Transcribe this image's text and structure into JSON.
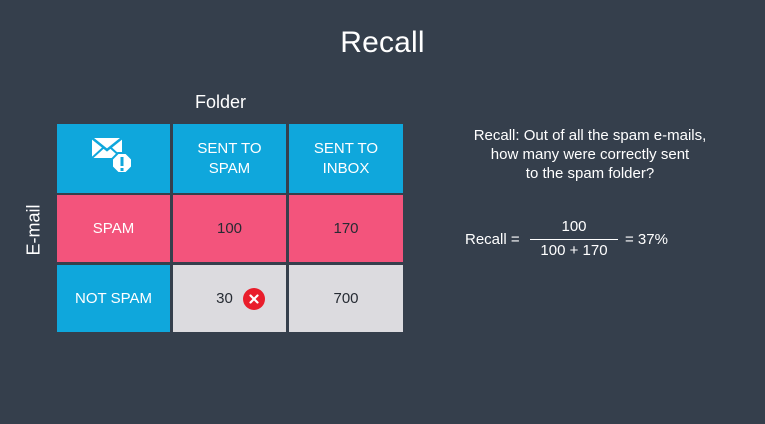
{
  "title": "Recall",
  "folder_label": "Folder",
  "email_label": "E-mail",
  "table": {
    "corner_icon": "spam-mail-warning-icon",
    "columns": [
      "SENT TO\nSPAM",
      "SENT TO\nINBOX"
    ],
    "rows": [
      {
        "label": "SPAM",
        "values": [
          "100",
          "170"
        ]
      },
      {
        "label": "NOT SPAM",
        "values": [
          "30",
          "700"
        ],
        "flag_icon": "close-icon"
      }
    ]
  },
  "explanation": {
    "line1": "Recall: Out of all the spam e-mails,",
    "line2": "how many were correctly sent",
    "line3": "to the spam folder?"
  },
  "formula": {
    "label": "Recall =",
    "numerator": "100",
    "denominator": "100 + 170",
    "result": "= 37%"
  },
  "colors": {
    "background": "#353f4c",
    "header_blue": "#0fa7dc",
    "spam_pink": "#f3547c",
    "cell_grey": "#dcdbdf",
    "error_red": "#e91d2b"
  }
}
